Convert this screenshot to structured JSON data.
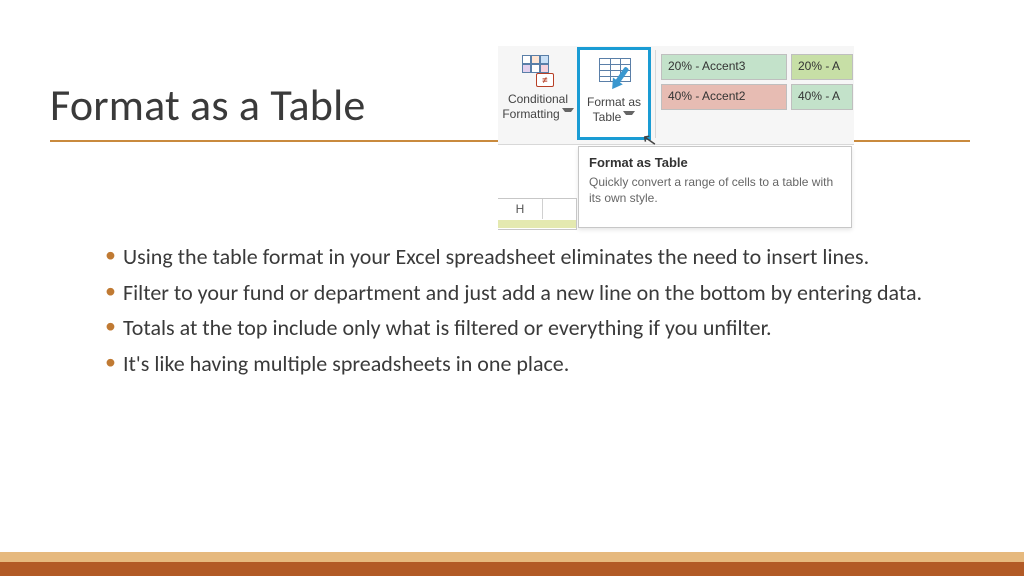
{
  "slide": {
    "title": "Format as a Table",
    "bullets": [
      "Using the table format in your Excel spreadsheet eliminates the need to insert lines.",
      "Filter to your fund or department and just add a new line on the bottom by entering data.",
      "Totals at the top include only what is filtered or everything if you unfilter.",
      "It's like having multiple spreadsheets in one place."
    ]
  },
  "ribbon": {
    "conditional_formatting": {
      "line1": "Conditional",
      "line2": "Formatting",
      "badge": "≠"
    },
    "format_as_table": {
      "line1": "Format as",
      "line2": "Table"
    },
    "swatches": {
      "accent3": "20% - Accent3",
      "accent_top_right": "20% - A",
      "accent2": "40% - Accent2",
      "accent_bottom_right": "40% - A"
    }
  },
  "tooltip": {
    "title": "Format as Table",
    "body": "Quickly convert a range of cells to a table with its own style."
  },
  "sheet": {
    "col": "H"
  }
}
